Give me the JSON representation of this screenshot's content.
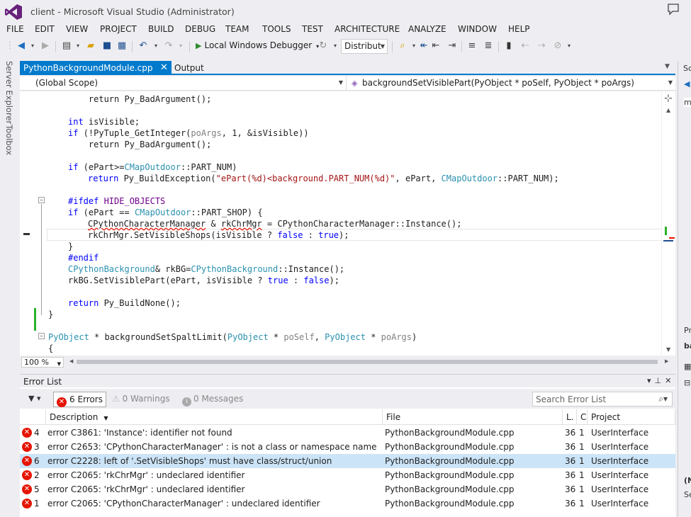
{
  "window": {
    "title": "client - Microsoft Visual Studio (Administrator)"
  },
  "menu": [
    "FILE",
    "EDIT",
    "VIEW",
    "PROJECT",
    "BUILD",
    "DEBUG",
    "TEAM",
    "TOOLS",
    "TEST",
    "ARCHITECTURE",
    "ANALYZE",
    "WINDOW",
    "HELP"
  ],
  "toolbar": {
    "debugger_label": "Local Windows Debugger",
    "config_value": "Distribut"
  },
  "left_rail": {
    "server_explorer": "Server Explorer",
    "toolbox": "Toolbox"
  },
  "tabs": {
    "active_file": "PythonBackgroundModule.cpp",
    "output": "Output"
  },
  "navbar": {
    "scope": "(Global Scope)",
    "member": "backgroundSetVisiblePart(PyObject * poSelf, PyObject * poArgs)"
  },
  "code": {
    "l0": "    return Py_BadArgument();",
    "l2_kw": "int",
    "l2_rest": " isVisible;",
    "l3_kw": "if",
    "l3_a": " (!PyTuple_GetInteger(",
    "l3_b": "poArgs",
    "l3_c": ", 1, &isVisible))",
    "l4": "    return Py_BadArgument();",
    "l6_kw": "if",
    "l6_a": " (ePart>=",
    "l6_ty": "CMapOutdoor",
    "l6_b": "::PART_NUM)",
    "l7_kw": "return",
    "l7_a": " Py_BuildException(",
    "l7_str": "\"ePart(%d)<background.PART_NUM(%d)\"",
    "l7_b": ", ePart, ",
    "l7_ty": "CMapOutdoor",
    "l7_c": "::PART_NUM);",
    "l9_pp": "#ifdef",
    "l9_mac": " HIDE_OBJECTS",
    "l10_kw": "if",
    "l10_a": " (ePart == ",
    "l10_ty": "CMapOutdoor",
    "l10_b": "::PART_SHOP) {",
    "l11_a": "CPythonCharacterManager",
    "l11_b": " & ",
    "l11_c": "rkChrMgr",
    "l11_d": " = ",
    "l11_e": "CPythonCharacterManager",
    "l11_f": "::Instance();",
    "l12_a": "rkChrMgr.SetVisibleShops(isVisible ? ",
    "l12_kw1": "false",
    "l12_b": " : ",
    "l12_kw2": "true",
    "l12_c": ");",
    "l13": "}",
    "l14_pp": "#endif",
    "l15_ty": "CPythonBackground",
    "l15_a": "& rkBG=",
    "l15_ty2": "CPythonBackground",
    "l15_b": "::Instance();",
    "l16_a": "rkBG.SetVisiblePart(ePart, isVisible ? ",
    "l16_kw1": "true",
    "l16_b": " : ",
    "l16_kw2": "false",
    "l16_c": ");",
    "l18_kw": "return",
    "l18_a": " Py_BuildNone();",
    "l19": "}",
    "l21_ty": "PyObject",
    "l21_a": " * backgroundSetSpaltLimit(",
    "l21_ty2": "PyObject",
    "l21_b": " * ",
    "l21_p1": "poSelf",
    "l21_c": ", ",
    "l21_ty3": "PyObject",
    "l21_d": " * ",
    "l21_p2": "poArgs",
    "l21_e": ")",
    "l22": "{"
  },
  "zoom": "100 %",
  "error_list": {
    "title": "Error List",
    "errors_filter": "6 Errors",
    "warnings_filter": "0 Warnings",
    "messages_filter": "0 Messages",
    "search_placeholder": "Search Error List",
    "columns": {
      "description": "Description",
      "file": "File",
      "line": "L.",
      "column": "C",
      "project": "Project"
    },
    "rows": [
      {
        "num": "4",
        "desc": "error C3861: 'Instance': identifier not found",
        "file": "PythonBackgroundModule.cpp",
        "line": "36!",
        "col": "1",
        "project": "UserInterface"
      },
      {
        "num": "3",
        "desc": "error C2653: 'CPythonCharacterManager' : is not a class or namespace name",
        "file": "PythonBackgroundModule.cpp",
        "line": "36!",
        "col": "1",
        "project": "UserInterface"
      },
      {
        "num": "6",
        "desc": "error C2228: left of '.SetVisibleShops' must have class/struct/union",
        "file": "PythonBackgroundModule.cpp",
        "line": "36!",
        "col": "1",
        "project": "UserInterface"
      },
      {
        "num": "2",
        "desc": "error C2065: 'rkChrMgr' : undeclared identifier",
        "file": "PythonBackgroundModule.cpp",
        "line": "36!",
        "col": "1",
        "project": "UserInterface"
      },
      {
        "num": "5",
        "desc": "error C2065: 'rkChrMgr' : undeclared identifier",
        "file": "PythonBackgroundModule.cpp",
        "line": "36!",
        "col": "1",
        "project": "UserInterface"
      },
      {
        "num": "1",
        "desc": "error C2065: 'CPythonCharacterManager' : undeclared identifier",
        "file": "PythonBackgroundModule.cpp",
        "line": "36!",
        "col": "1",
        "project": "UserInterface"
      }
    ]
  },
  "right_panel": {
    "top_label": "Sc",
    "search_value": "m",
    "mid_label": "Pr",
    "mid_value": "ba",
    "bottom_label": "(N",
    "bottom_value": "Se"
  },
  "colors": {
    "accent": "#007acc",
    "error": "#e51400",
    "change_bar": "#29b229",
    "keyword": "#0000ff",
    "type": "#2b91af",
    "string": "#a31515",
    "macro": "#6f008a"
  }
}
